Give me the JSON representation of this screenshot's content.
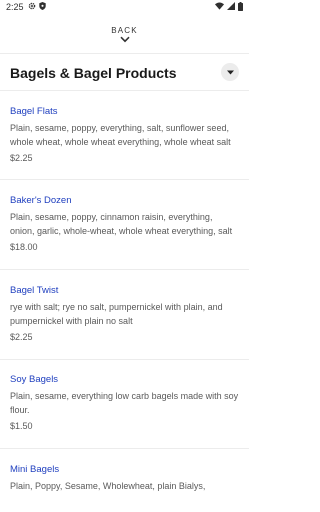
{
  "status_bar": {
    "time": "2:25"
  },
  "header": {
    "back_label": "BACK"
  },
  "category": {
    "title": "Bagels & Bagel Products"
  },
  "items": [
    {
      "name": "Bagel Flats",
      "description": "Plain, sesame, poppy, everything, salt, sunflower seed, whole wheat, whole wheat everything, whole wheat salt",
      "price": "$2.25"
    },
    {
      "name": "Baker's Dozen",
      "description": "Plain, sesame, poppy, cinnamon raisin, everything, onion, garlic, whole-wheat, whole wheat everything, salt",
      "price": "$18.00"
    },
    {
      "name": "Bagel Twist",
      "description": "rye with salt; rye no salt,  pumpernickel with plain, and pumpernickel with plain no salt",
      "price": "$2.25"
    },
    {
      "name": "Soy Bagels",
      "description": "Plain, sesame, everything low carb bagels made with soy flour.",
      "price": "$1.50"
    },
    {
      "name": "Mini Bagels",
      "description": "Plain, Poppy, Sesame, Wholewheat, plain Bialys,",
      "price": ""
    }
  ]
}
